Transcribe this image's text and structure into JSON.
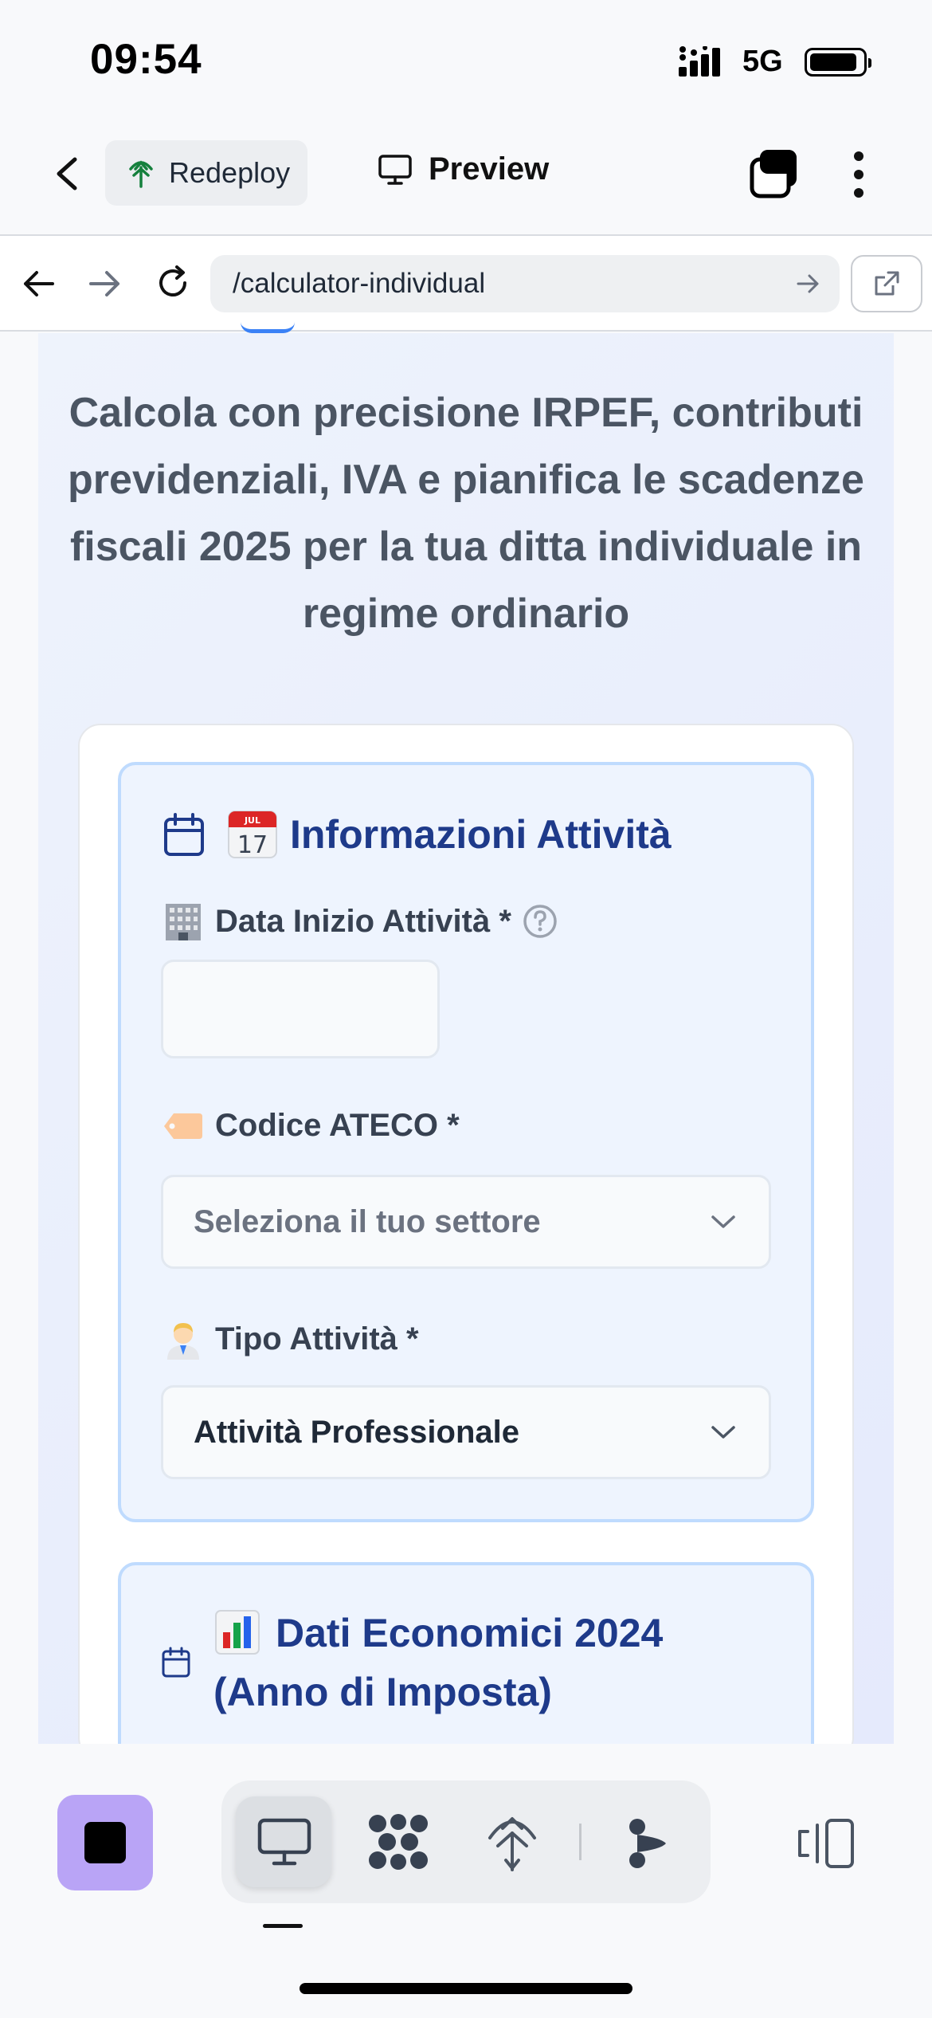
{
  "status_bar": {
    "time": "09:54",
    "network": "5G"
  },
  "toolbar": {
    "redeploy_label": "Redeploy",
    "preview_label": "Preview"
  },
  "browser": {
    "url": "/calculator-individual"
  },
  "page": {
    "intro_text": "Calcola con precisione IRPEF, contributi previdenziali, IVA e pianifica le scadenze fiscali 2025 per la tua ditta individuale in regime ordinario"
  },
  "section_activity": {
    "title": "Informazioni Attività",
    "start_date_label": "Data Inizio Attività *",
    "start_date_value": "",
    "ateco_label": "Codice ATECO *",
    "ateco_placeholder": "Seleziona il tuo settore",
    "type_label": "Tipo Attività *",
    "type_value": "Attività Professionale"
  },
  "section_economic": {
    "title_line1": "Dati Economici 2024",
    "title_line2": "(Anno di Imposta)"
  },
  "colors": {
    "accent": "#1e3a8a",
    "section_border": "#bfdbfe",
    "stop_button": "#b9a4f6"
  }
}
